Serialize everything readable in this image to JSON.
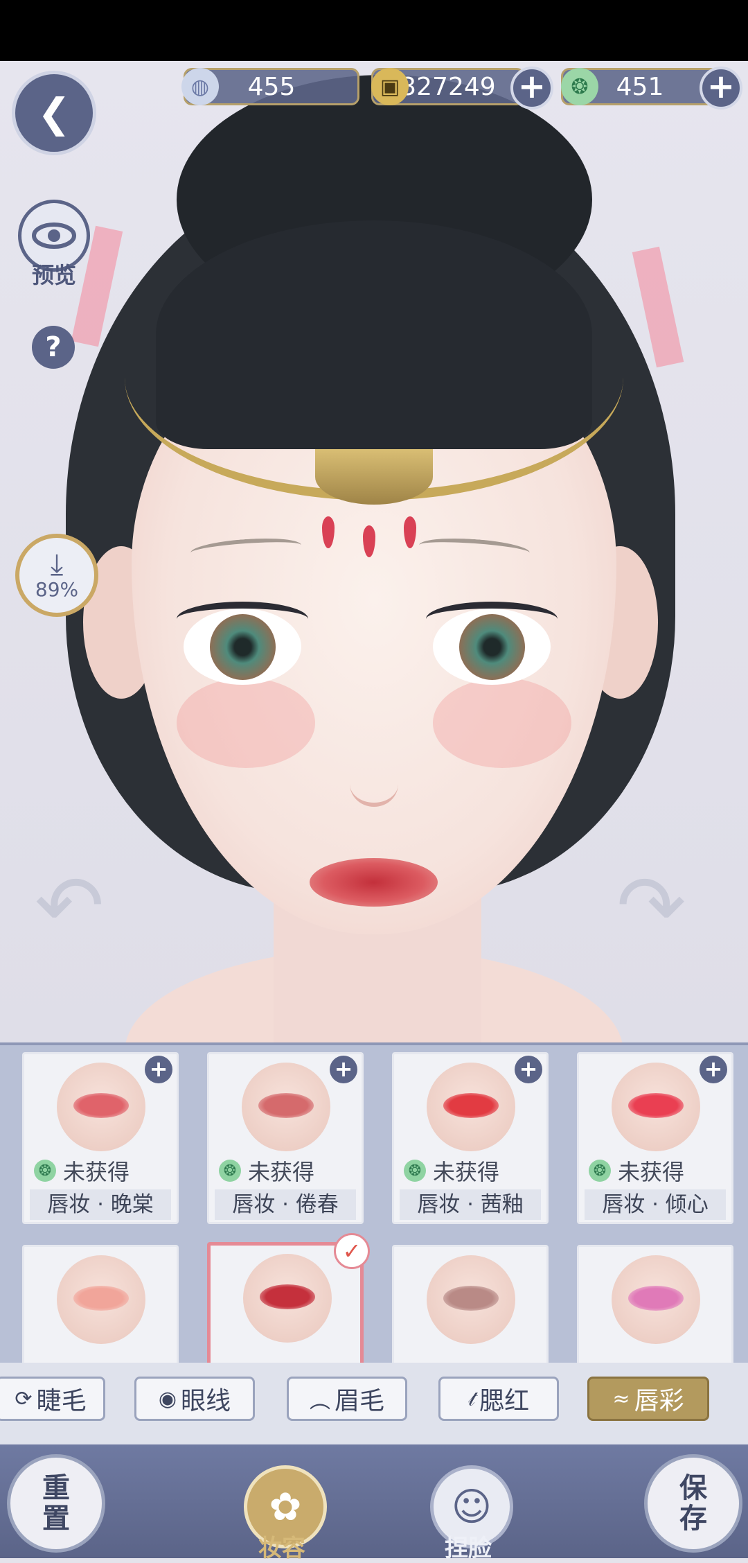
{
  "currencies": [
    {
      "name": "silver-jade",
      "value": "455",
      "icon": "silver-coin-icon",
      "add_button": false
    },
    {
      "name": "copper-coin",
      "value": "327249",
      "icon": "copper-coin-icon",
      "add_button": true
    },
    {
      "name": "green-jade",
      "value": "451",
      "icon": "green-jade-icon",
      "add_button": true
    }
  ],
  "side": {
    "preview_label": "预览",
    "help_symbol": "?",
    "download_percent": "89%"
  },
  "products_row1": [
    {
      "status": "未获得",
      "name": "唇妆 · 晚棠",
      "lip_color": "#e0636a"
    },
    {
      "status": "未获得",
      "name": "唇妆 · 倦春",
      "lip_color": "#d56a6c"
    },
    {
      "status": "未获得",
      "name": "唇妆 · 茜釉",
      "lip_color": "#e23b42"
    },
    {
      "status": "未获得",
      "name": "唇妆 · 倾心",
      "lip_color": "#ea3f52"
    }
  ],
  "products_row2": [
    {
      "lip_color": "#f1a59a",
      "selected": false
    },
    {
      "lip_color": "#c5303c",
      "selected": true
    },
    {
      "lip_color": "#b98a86",
      "selected": false
    },
    {
      "lip_color": "#e07ab8",
      "selected": false
    }
  ],
  "tabs": [
    {
      "label": "睫毛",
      "icon": "lash-icon",
      "glyph": "⟳",
      "active": false
    },
    {
      "label": "眼线",
      "icon": "eyeliner-icon",
      "glyph": "◉",
      "active": false
    },
    {
      "label": "眉毛",
      "icon": "brow-icon",
      "glyph": "︵",
      "active": false
    },
    {
      "label": "腮红",
      "icon": "blush-icon",
      "glyph": "𝓉",
      "active": false
    },
    {
      "label": "唇彩",
      "icon": "lip-icon",
      "glyph": "≈",
      "active": true
    }
  ],
  "bottom": {
    "reset_line1": "重",
    "reset_line2": "置",
    "makeup_label": "妆容",
    "face_label": "捏脸",
    "save_line1": "保",
    "save_line2": "存"
  },
  "colors": {
    "accent": "#5b6488",
    "gold": "#b39a5e",
    "selected_border": "#e58a95"
  }
}
